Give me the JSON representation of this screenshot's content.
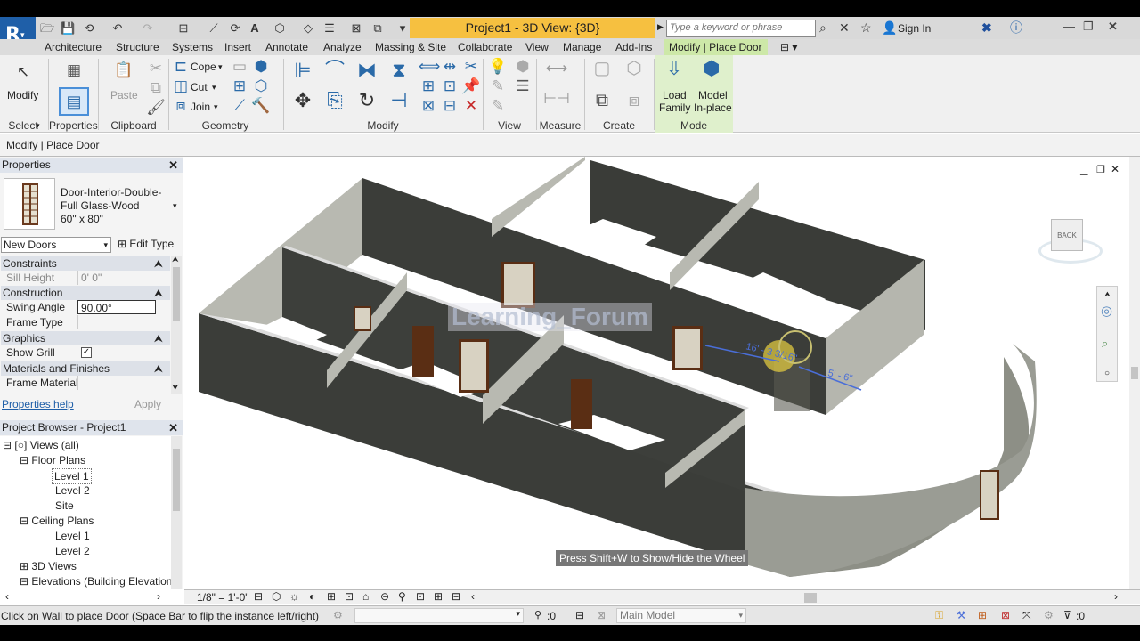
{
  "app": {
    "logo": "R",
    "title": "Project1 - 3D View: {3D}",
    "search_placeholder": "Type a keyword or phrase",
    "sign_in": "Sign In"
  },
  "tabs": [
    "Architecture",
    "Structure",
    "Systems",
    "Insert",
    "Annotate",
    "Analyze",
    "Massing & Site",
    "Collaborate",
    "View",
    "Manage",
    "Add-Ins"
  ],
  "active_tab": "Modify | Place Door",
  "ribbon": {
    "modify_label": "Modify",
    "paste_label": "Paste",
    "cope_label": "Cope",
    "cut_label": "Cut",
    "join_label": "Join",
    "load_family_label": "Load Family",
    "load_family_line1": "Load",
    "load_family_line2": "Family",
    "model_inplace_line1": "Model",
    "model_inplace_line2": "In-place",
    "panels": {
      "select": "Select",
      "properties": "Properties",
      "clipboard": "Clipboard",
      "geometry": "Geometry",
      "modify": "Modify",
      "view": "View",
      "measure": "Measure",
      "create": "Create",
      "mode": "Mode"
    }
  },
  "context_bar": "Modify | Place Door",
  "properties": {
    "header": "Properties",
    "type_line1": "Door-Interior-Double-",
    "type_line2": "Full Glass-Wood",
    "type_line3": "60\" x 80\"",
    "instance_selector": "New Doors",
    "edit_type": "Edit Type",
    "sections": {
      "constraints": "Constraints",
      "construction": "Construction",
      "graphics": "Graphics",
      "materials": "Materials and Finishes"
    },
    "rows": {
      "sill_height_label": "Sill Height",
      "sill_height_value": "0'  0\"",
      "swing_angle_label": "Swing Angle",
      "swing_angle_value": "90.00°",
      "frame_type_label": "Frame Type",
      "show_grill_label": "Show Grill",
      "frame_material_label": "Frame Material"
    },
    "help_link": "Properties help",
    "apply": "Apply"
  },
  "project_browser": {
    "header": "Project Browser - Project1",
    "items": {
      "views_all": "Views (all)",
      "floor_plans": "Floor Plans",
      "fp_level1": "Level 1",
      "fp_level2": "Level 2",
      "fp_site": "Site",
      "ceiling_plans": "Ceiling Plans",
      "cp_level1": "Level 1",
      "cp_level2": "Level 2",
      "views_3d": "3D Views",
      "elevations": "Elevations (Building Elevation"
    }
  },
  "viewport": {
    "watermark": "Learning_Forum",
    "wheel_tip": "Press Shift+W to Show/Hide the Wheel",
    "dim_left": "16' - 3 3/16\"",
    "dim_right": "5' - 6\"",
    "viewcube_label": "BACK"
  },
  "view_bar": {
    "scale": "1/8\" = 1'-0\""
  },
  "status_bar": {
    "message": "Click on Wall to place Door (Space Bar to flip the instance left/right)",
    "count": ":0",
    "model": "Main Model",
    "filter_count": ":0"
  },
  "colors": {
    "accent": "#cde8a8",
    "title_highlight": "#f6c040",
    "wall_dark": "#3b3d39",
    "wall_light": "#b8b9b1"
  }
}
